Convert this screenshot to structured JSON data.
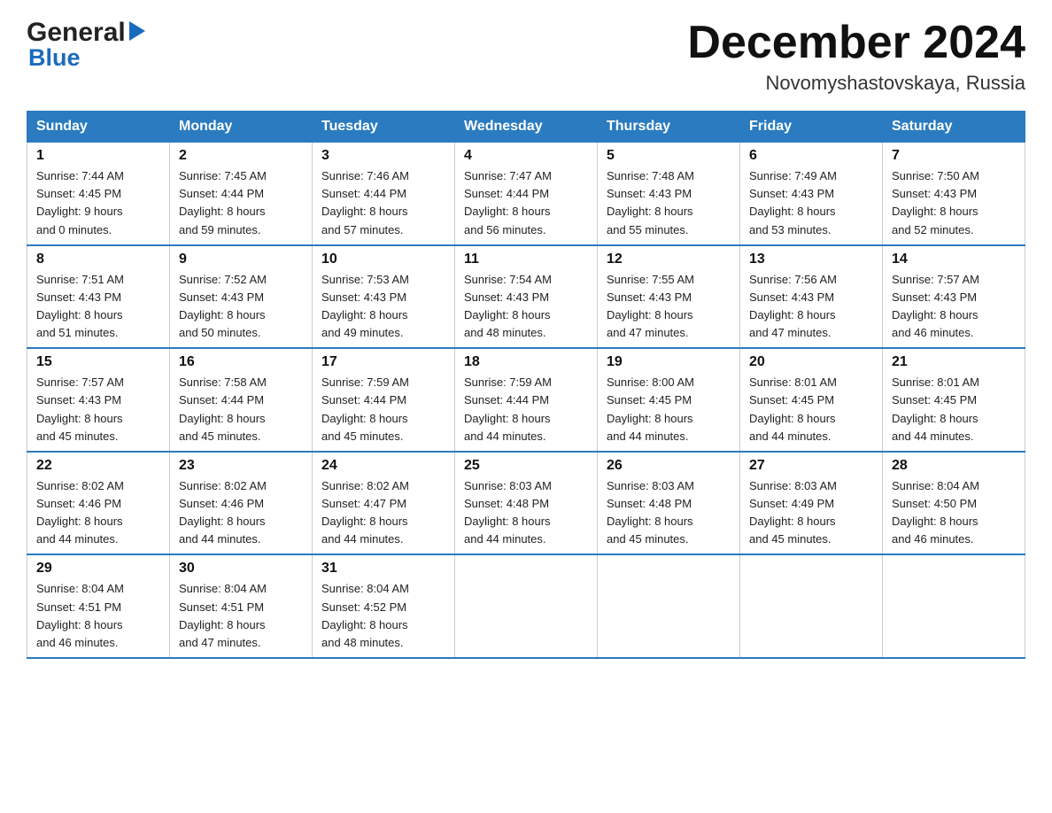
{
  "logo": {
    "general": "General",
    "blue": "Blue",
    "arrow": "▶"
  },
  "title": "December 2024",
  "subtitle": "Novomyshastovskaya, Russia",
  "days_of_week": [
    "Sunday",
    "Monday",
    "Tuesday",
    "Wednesday",
    "Thursday",
    "Friday",
    "Saturday"
  ],
  "weeks": [
    [
      {
        "day": "1",
        "info": "Sunrise: 7:44 AM\nSunset: 4:45 PM\nDaylight: 9 hours\nand 0 minutes."
      },
      {
        "day": "2",
        "info": "Sunrise: 7:45 AM\nSunset: 4:44 PM\nDaylight: 8 hours\nand 59 minutes."
      },
      {
        "day": "3",
        "info": "Sunrise: 7:46 AM\nSunset: 4:44 PM\nDaylight: 8 hours\nand 57 minutes."
      },
      {
        "day": "4",
        "info": "Sunrise: 7:47 AM\nSunset: 4:44 PM\nDaylight: 8 hours\nand 56 minutes."
      },
      {
        "day": "5",
        "info": "Sunrise: 7:48 AM\nSunset: 4:43 PM\nDaylight: 8 hours\nand 55 minutes."
      },
      {
        "day": "6",
        "info": "Sunrise: 7:49 AM\nSunset: 4:43 PM\nDaylight: 8 hours\nand 53 minutes."
      },
      {
        "day": "7",
        "info": "Sunrise: 7:50 AM\nSunset: 4:43 PM\nDaylight: 8 hours\nand 52 minutes."
      }
    ],
    [
      {
        "day": "8",
        "info": "Sunrise: 7:51 AM\nSunset: 4:43 PM\nDaylight: 8 hours\nand 51 minutes."
      },
      {
        "day": "9",
        "info": "Sunrise: 7:52 AM\nSunset: 4:43 PM\nDaylight: 8 hours\nand 50 minutes."
      },
      {
        "day": "10",
        "info": "Sunrise: 7:53 AM\nSunset: 4:43 PM\nDaylight: 8 hours\nand 49 minutes."
      },
      {
        "day": "11",
        "info": "Sunrise: 7:54 AM\nSunset: 4:43 PM\nDaylight: 8 hours\nand 48 minutes."
      },
      {
        "day": "12",
        "info": "Sunrise: 7:55 AM\nSunset: 4:43 PM\nDaylight: 8 hours\nand 47 minutes."
      },
      {
        "day": "13",
        "info": "Sunrise: 7:56 AM\nSunset: 4:43 PM\nDaylight: 8 hours\nand 47 minutes."
      },
      {
        "day": "14",
        "info": "Sunrise: 7:57 AM\nSunset: 4:43 PM\nDaylight: 8 hours\nand 46 minutes."
      }
    ],
    [
      {
        "day": "15",
        "info": "Sunrise: 7:57 AM\nSunset: 4:43 PM\nDaylight: 8 hours\nand 45 minutes."
      },
      {
        "day": "16",
        "info": "Sunrise: 7:58 AM\nSunset: 4:44 PM\nDaylight: 8 hours\nand 45 minutes."
      },
      {
        "day": "17",
        "info": "Sunrise: 7:59 AM\nSunset: 4:44 PM\nDaylight: 8 hours\nand 45 minutes."
      },
      {
        "day": "18",
        "info": "Sunrise: 7:59 AM\nSunset: 4:44 PM\nDaylight: 8 hours\nand 44 minutes."
      },
      {
        "day": "19",
        "info": "Sunrise: 8:00 AM\nSunset: 4:45 PM\nDaylight: 8 hours\nand 44 minutes."
      },
      {
        "day": "20",
        "info": "Sunrise: 8:01 AM\nSunset: 4:45 PM\nDaylight: 8 hours\nand 44 minutes."
      },
      {
        "day": "21",
        "info": "Sunrise: 8:01 AM\nSunset: 4:45 PM\nDaylight: 8 hours\nand 44 minutes."
      }
    ],
    [
      {
        "day": "22",
        "info": "Sunrise: 8:02 AM\nSunset: 4:46 PM\nDaylight: 8 hours\nand 44 minutes."
      },
      {
        "day": "23",
        "info": "Sunrise: 8:02 AM\nSunset: 4:46 PM\nDaylight: 8 hours\nand 44 minutes."
      },
      {
        "day": "24",
        "info": "Sunrise: 8:02 AM\nSunset: 4:47 PM\nDaylight: 8 hours\nand 44 minutes."
      },
      {
        "day": "25",
        "info": "Sunrise: 8:03 AM\nSunset: 4:48 PM\nDaylight: 8 hours\nand 44 minutes."
      },
      {
        "day": "26",
        "info": "Sunrise: 8:03 AM\nSunset: 4:48 PM\nDaylight: 8 hours\nand 45 minutes."
      },
      {
        "day": "27",
        "info": "Sunrise: 8:03 AM\nSunset: 4:49 PM\nDaylight: 8 hours\nand 45 minutes."
      },
      {
        "day": "28",
        "info": "Sunrise: 8:04 AM\nSunset: 4:50 PM\nDaylight: 8 hours\nand 46 minutes."
      }
    ],
    [
      {
        "day": "29",
        "info": "Sunrise: 8:04 AM\nSunset: 4:51 PM\nDaylight: 8 hours\nand 46 minutes."
      },
      {
        "day": "30",
        "info": "Sunrise: 8:04 AM\nSunset: 4:51 PM\nDaylight: 8 hours\nand 47 minutes."
      },
      {
        "day": "31",
        "info": "Sunrise: 8:04 AM\nSunset: 4:52 PM\nDaylight: 8 hours\nand 48 minutes."
      },
      {
        "day": "",
        "info": ""
      },
      {
        "day": "",
        "info": ""
      },
      {
        "day": "",
        "info": ""
      },
      {
        "day": "",
        "info": ""
      }
    ]
  ]
}
